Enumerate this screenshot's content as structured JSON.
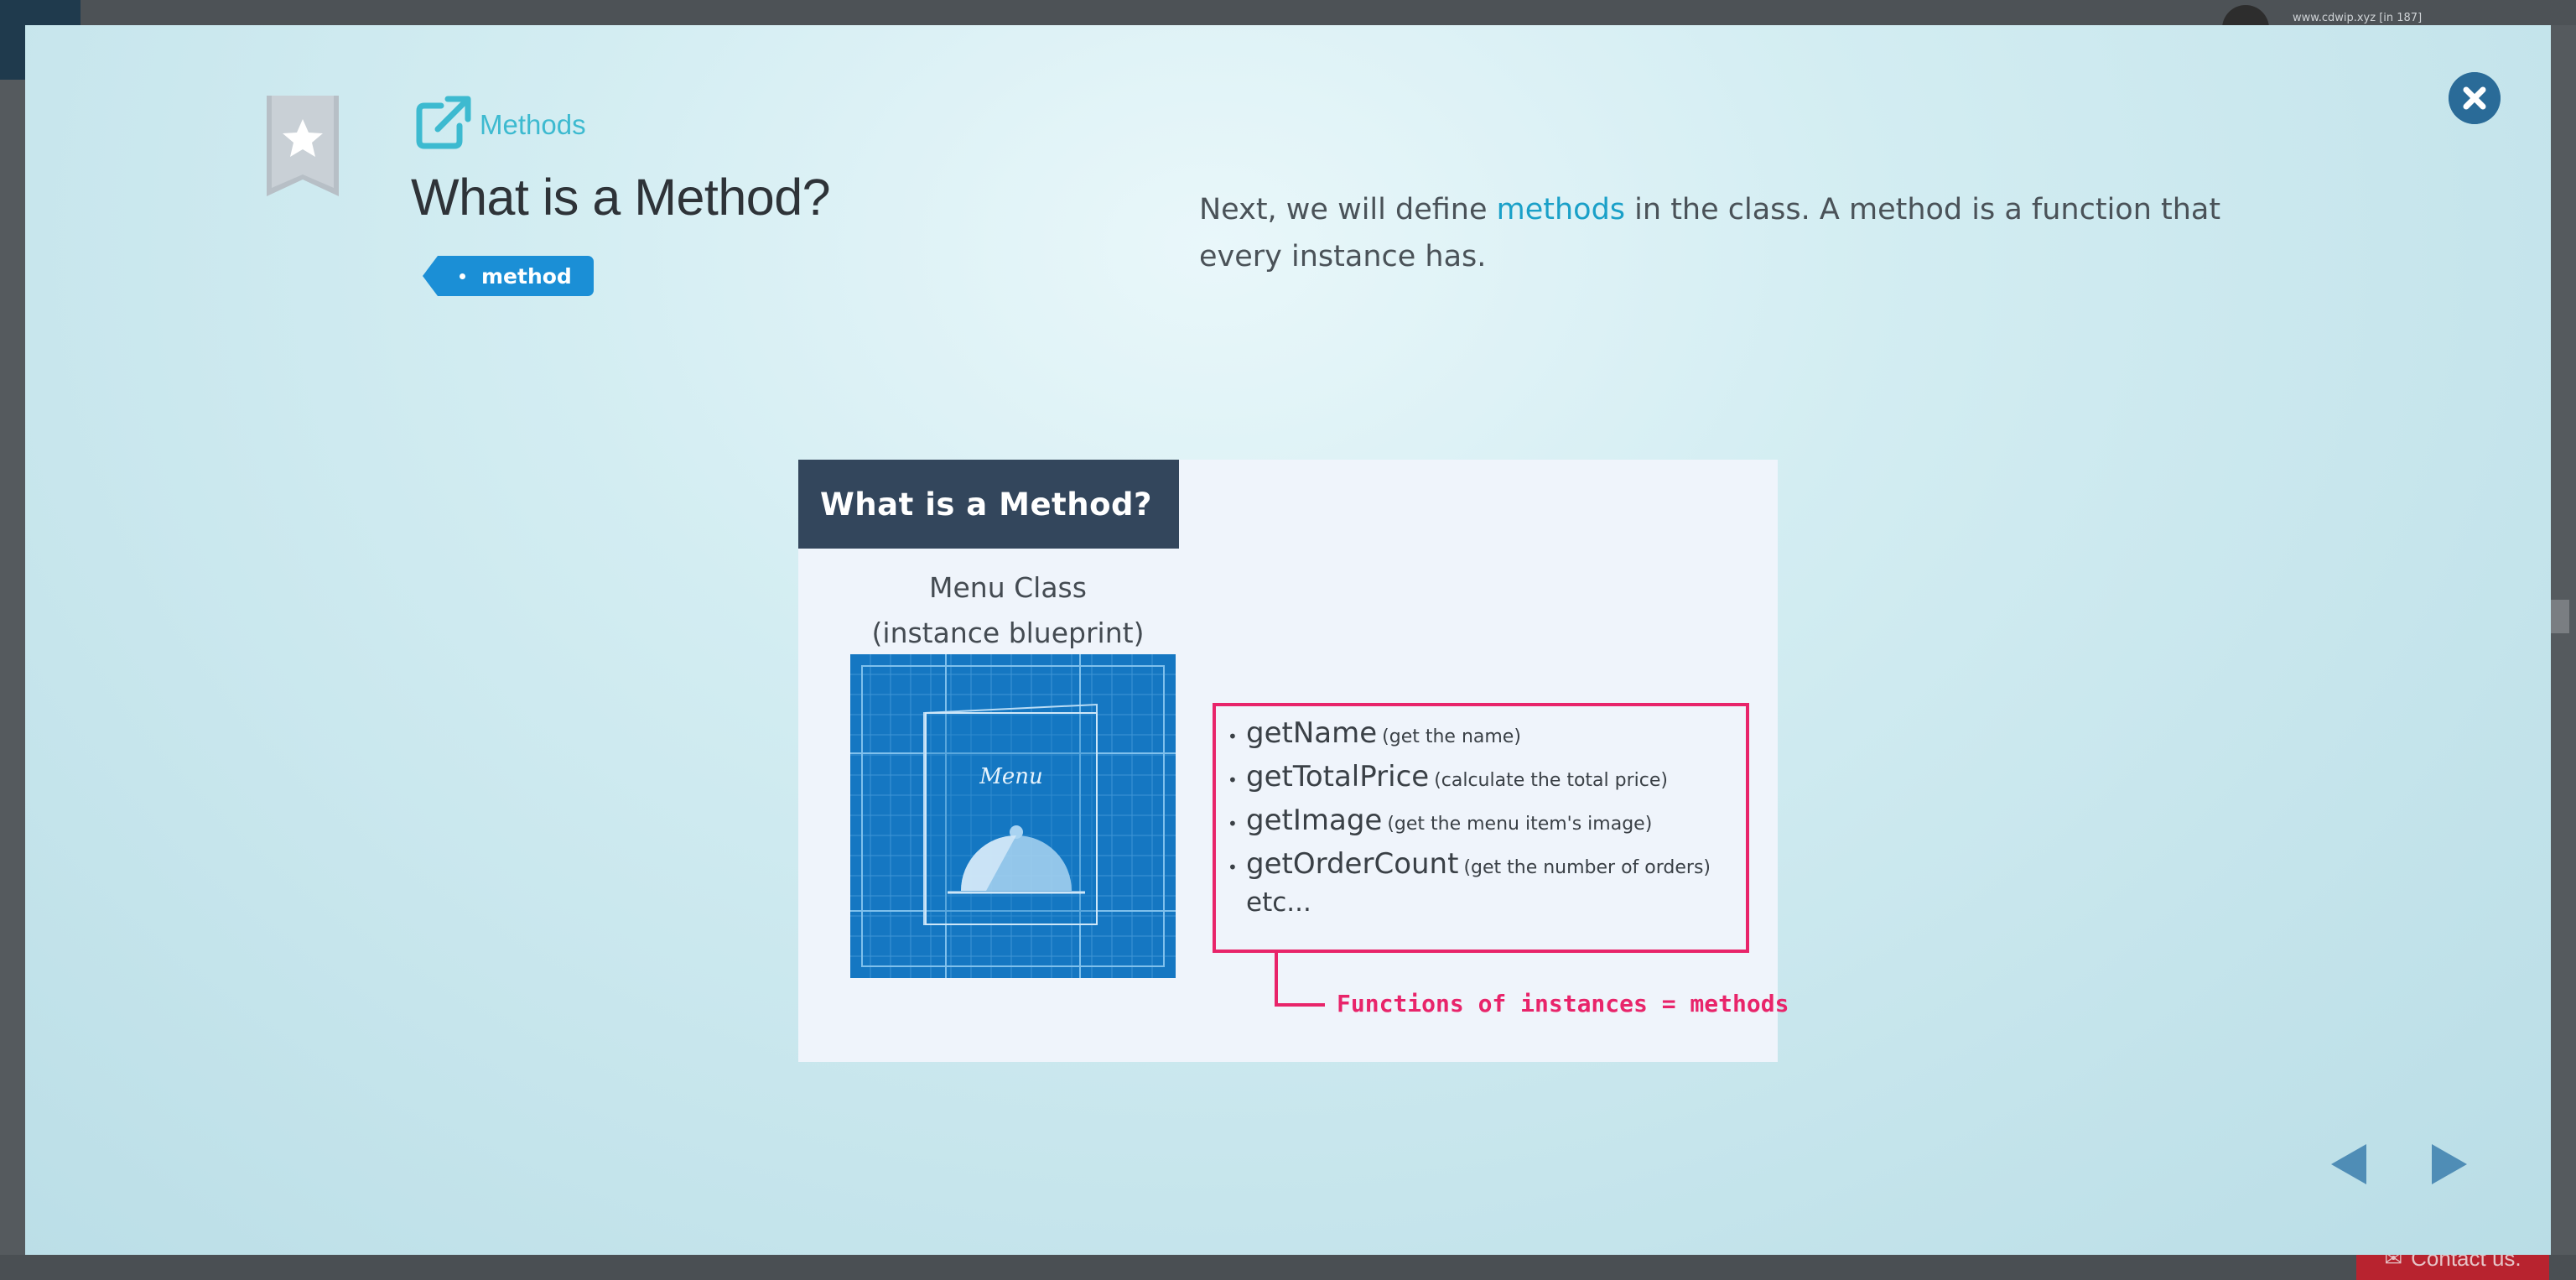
{
  "background": {
    "url_text": "www.cdwip.xyz [in 187]",
    "contact_label": "Contact us."
  },
  "modal": {
    "breadcrumb": "Methods",
    "title": "What is a Method?",
    "tag": "method",
    "description_before": "Next, we will define ",
    "description_keyword": "methods",
    "description_after": " in the class. A method is a function that every instance has.",
    "accent_color": "#3dbad0",
    "tag_color": "#1b8fd6"
  },
  "slide": {
    "header": "What is a Method?",
    "class_title_line1": "Menu Class",
    "class_title_line2": "(instance blueprint)",
    "blueprint_label": "Menu",
    "methods": [
      {
        "name": "getName",
        "desc": "(get the name)"
      },
      {
        "name": "getTotalPrice",
        "desc": "(calculate the total price)"
      },
      {
        "name": "getImage",
        "desc": "(get the menu item's image)"
      },
      {
        "name": "getOrderCount",
        "desc": "(get the number of orders)"
      }
    ],
    "etc": "etc...",
    "connector_label": "Functions of instances = methods",
    "highlight_color": "#e8246a"
  },
  "icons": {
    "bookmark": "bookmark-star-icon",
    "external_link": "external-link-icon",
    "close": "close-icon",
    "prev": "arrow-left-icon",
    "next": "arrow-right-icon"
  }
}
